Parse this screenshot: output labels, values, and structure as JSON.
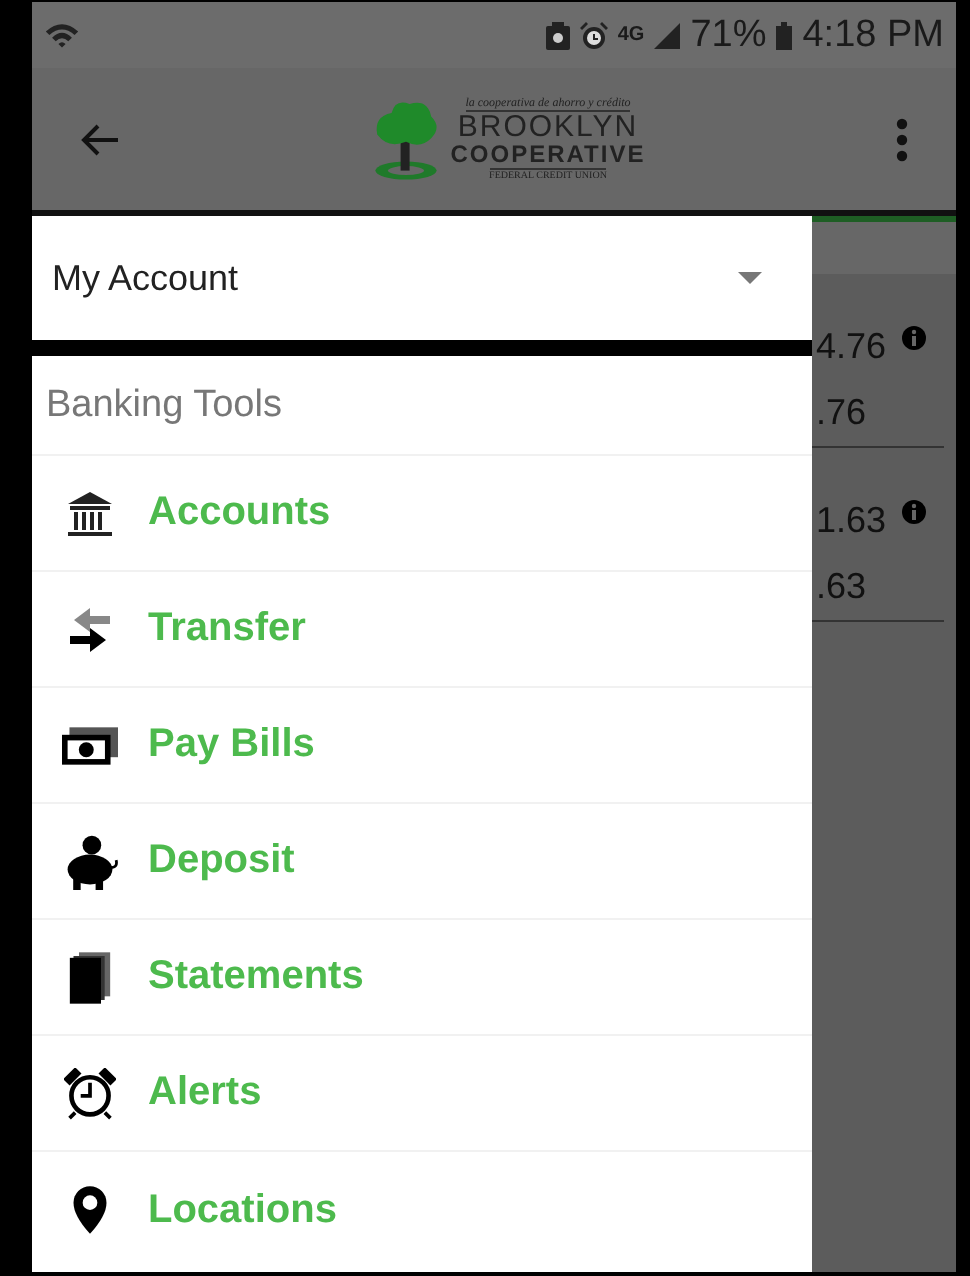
{
  "status_bar": {
    "network": "4G",
    "battery": "71%",
    "time": "4:18 PM"
  },
  "app_bar": {
    "logo": {
      "tagline": "la cooperativa de ahorro y crédito",
      "name_top": "BROOKLYN",
      "name_bottom": "COOPERATIVE",
      "subtitle": "FEDERAL CREDIT UNION"
    }
  },
  "background": {
    "values": [
      {
        "amount": "4.76",
        "info": true
      },
      {
        "amount": ".76",
        "info": false
      },
      {
        "amount": "1.63",
        "info": true
      },
      {
        "amount": ".63",
        "info": false
      }
    ]
  },
  "drawer": {
    "account_select": {
      "value": "My Account"
    },
    "section": "Banking Tools",
    "items": [
      {
        "kind": "bank",
        "label": "Accounts"
      },
      {
        "kind": "transfer",
        "label": "Transfer"
      },
      {
        "kind": "bills",
        "label": "Pay Bills"
      },
      {
        "kind": "piggy",
        "label": "Deposit"
      },
      {
        "kind": "statements",
        "label": "Statements"
      },
      {
        "kind": "alarm",
        "label": "Alerts"
      },
      {
        "kind": "location",
        "label": "Locations"
      }
    ]
  }
}
